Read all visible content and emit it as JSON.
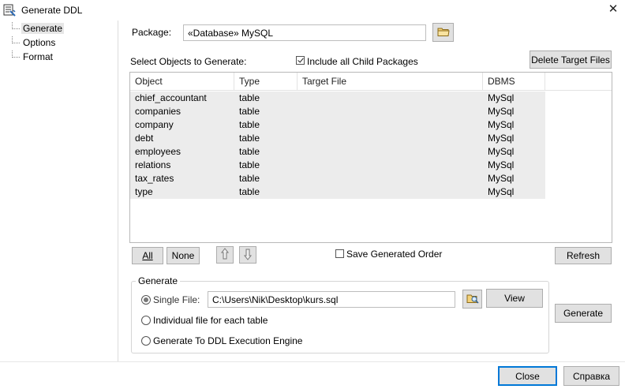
{
  "window": {
    "title": "Generate DDL",
    "icon": "ddl-app-icon",
    "close_glyph": "✕"
  },
  "tree": {
    "items": [
      {
        "label": "Generate",
        "selected": true
      },
      {
        "label": "Options",
        "selected": false
      },
      {
        "label": "Format",
        "selected": false
      }
    ]
  },
  "package": {
    "label": "Package:",
    "value": "«Database» MySQL",
    "browse_icon": "folder-icon"
  },
  "objects": {
    "label": "Select Objects to Generate:",
    "include_child_label": "Include all Child Packages",
    "include_child_checked": true,
    "delete_target_label": "Delete Target Files",
    "columns": [
      "Object",
      "Type",
      "Target File",
      "DBMS"
    ],
    "rows": [
      {
        "object": "chief_accountant",
        "type": "table",
        "target": "",
        "dbms": "MySql"
      },
      {
        "object": "companies",
        "type": "table",
        "target": "",
        "dbms": "MySql"
      },
      {
        "object": "company",
        "type": "table",
        "target": "",
        "dbms": "MySql"
      },
      {
        "object": "debt",
        "type": "table",
        "target": "",
        "dbms": "MySql"
      },
      {
        "object": "employees",
        "type": "table",
        "target": "",
        "dbms": "MySql"
      },
      {
        "object": "relations",
        "type": "table",
        "target": "",
        "dbms": "MySql"
      },
      {
        "object": "tax_rates",
        "type": "table",
        "target": "",
        "dbms": "MySql"
      },
      {
        "object": "type",
        "type": "table",
        "target": "",
        "dbms": "MySql"
      }
    ]
  },
  "selection": {
    "all_label": "All",
    "none_label": "None",
    "move_up_icon": "move-up-icon",
    "move_down_icon": "move-down-icon",
    "save_order_label": "Save Generated Order",
    "save_order_checked": false,
    "refresh_label": "Refresh"
  },
  "generate_group": {
    "title": "Generate",
    "single_file_label": "Single File:",
    "single_file_selected": true,
    "file_path": "C:\\Users\\Nik\\Desktop\\kurs.sql",
    "view_label": "View",
    "individual_label": "Individual file for each table",
    "engine_label": "Generate To DDL Execution Engine"
  },
  "actions": {
    "generate_label": "Generate",
    "close_label": "Close",
    "help_label": "Справка"
  },
  "colors": {
    "selected_row_bg": "#ececec",
    "button_bg": "#e1e1e1",
    "default_button_border": "#0078d7"
  }
}
